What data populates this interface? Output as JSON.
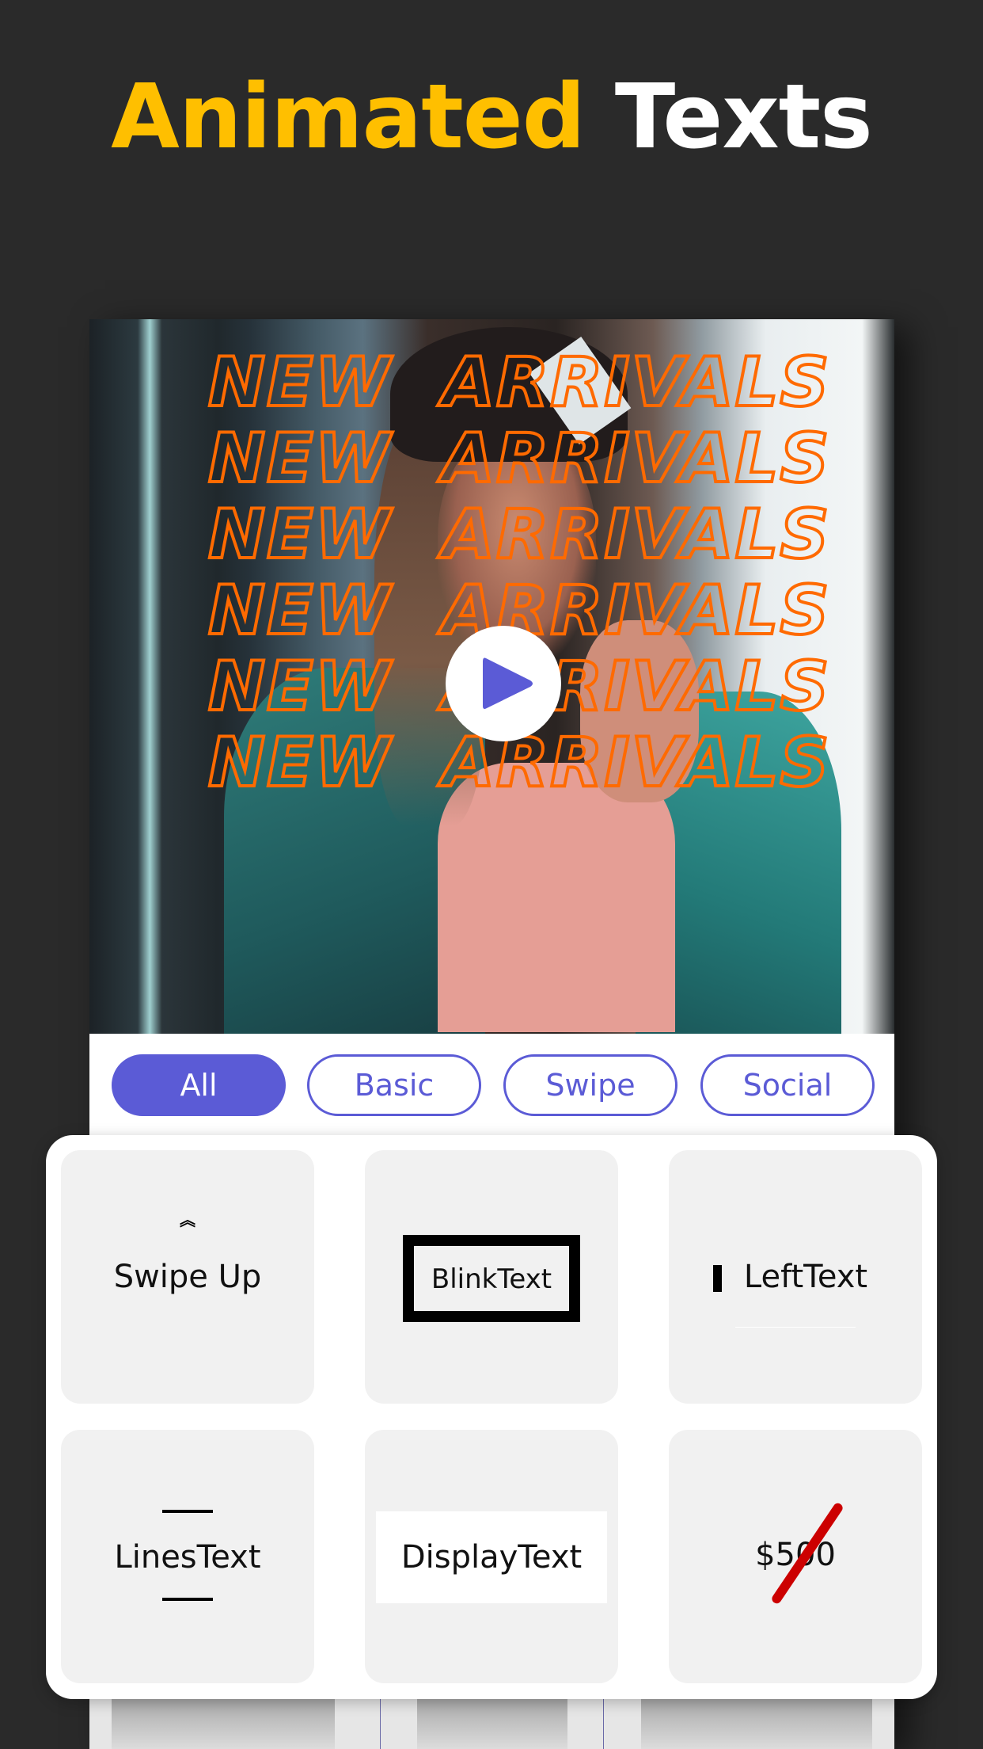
{
  "headline": {
    "word_highlight": "Animated",
    "word_plain": "Texts",
    "highlight_color": "#ffbf00",
    "plain_color": "#ffffff"
  },
  "preview": {
    "overlay_text_lines": [
      "NEW  ARRIVALS",
      "NEW  ARRIVALS",
      "NEW  ARRIVALS",
      "NEW  ARRIVALS",
      "NEW  ARRIVALS",
      "NEW  ARRIVALS"
    ],
    "overlay_text_color": "#ff6a00",
    "play_icon": "play-icon",
    "accent_color": "#5b5bd6"
  },
  "tabs": [
    {
      "label": "All",
      "active": true
    },
    {
      "label": "Basic",
      "active": false
    },
    {
      "label": "Swipe",
      "active": false
    },
    {
      "label": "Social",
      "active": false
    }
  ],
  "cards": [
    {
      "label": "Swipe Up",
      "icon": "double-chevron-up-icon",
      "icon_glyph": "︽"
    },
    {
      "label": "BlinkText"
    },
    {
      "label": "LeftText"
    },
    {
      "label": "LinesText"
    },
    {
      "label": "DisplayText"
    },
    {
      "label": "$500",
      "strike_color": "#cc0000"
    }
  ]
}
